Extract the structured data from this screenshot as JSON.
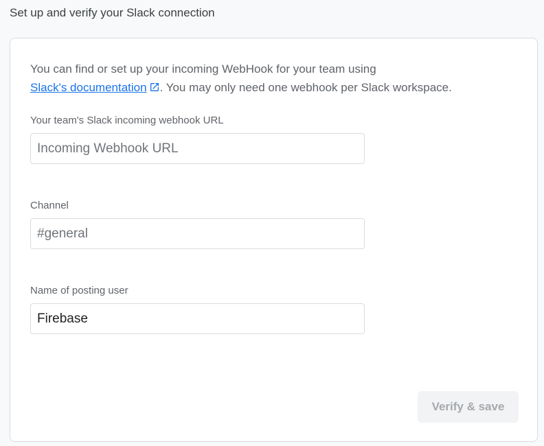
{
  "page": {
    "heading": "Set up and verify your Slack connection"
  },
  "intro": {
    "text_before": "You can find or set up your incoming WebHook for your team using",
    "link_label": "Slack's documentation",
    "text_after": ". You may only need one webhook per Slack workspace."
  },
  "form": {
    "webhook": {
      "label": "Your team's Slack incoming webhook URL",
      "value": "",
      "placeholder": "Incoming Webhook URL"
    },
    "channel": {
      "label": "Channel",
      "value": "",
      "placeholder": "#general"
    },
    "posting_user": {
      "label": "Name of posting user",
      "value": "Firebase",
      "placeholder": ""
    },
    "save_label": "Verify & save"
  },
  "icons": {
    "link": "open-in-new-icon"
  },
  "colors": {
    "link": "#1a73e8",
    "button_disabled_bg": "#f1f3f4",
    "button_disabled_text": "#a6a9ad"
  }
}
